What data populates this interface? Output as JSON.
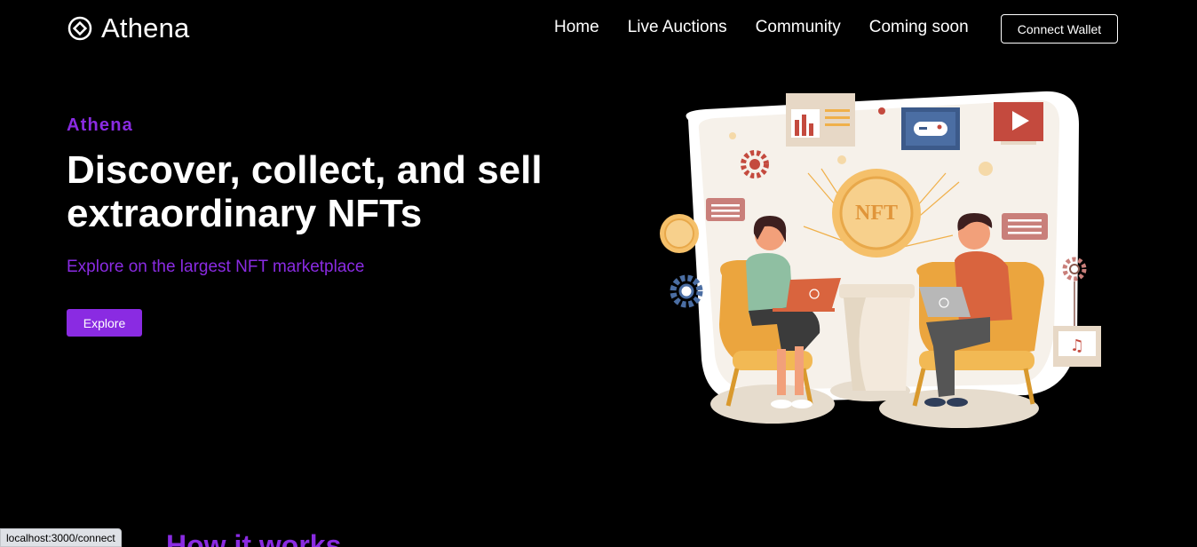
{
  "nav": {
    "brand": "Athena",
    "links": [
      "Home",
      "Live Auctions",
      "Community",
      "Coming soon"
    ],
    "wallet_label": "Connect Wallet"
  },
  "hero": {
    "eyebrow": "Athena",
    "headline": "Discover, collect, and sell extraordinary NFTs",
    "subline": "Explore on the largest NFT marketplace",
    "cta": "Explore"
  },
  "illustration": {
    "coin_text": "NFT",
    "icons": [
      "bar-chart-icon",
      "gamepad-icon",
      "play-icon",
      "chat-bubble-icon",
      "gear-icon",
      "coin-icon",
      "music-note-icon",
      "laptop-icon"
    ]
  },
  "next_section": {
    "title": "How it works"
  },
  "status_bar": {
    "url": "localhost:3000/connect"
  },
  "colors": {
    "background": "#000000",
    "accent": "#8a2be2",
    "text": "#ffffff"
  }
}
